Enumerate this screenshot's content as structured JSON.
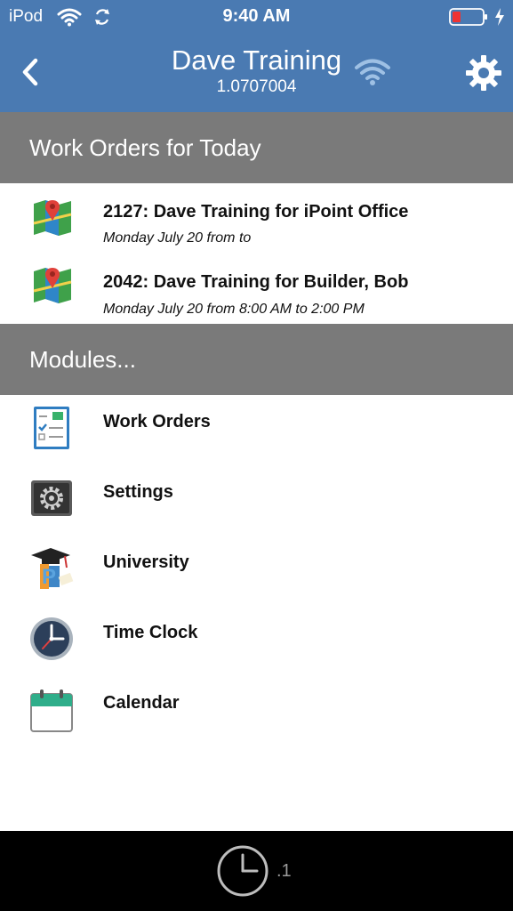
{
  "status_bar": {
    "carrier": "iPod",
    "time": "9:40 AM",
    "icons": [
      "wifi-icon",
      "sync-icon",
      "battery-icon",
      "charging-icon"
    ]
  },
  "header": {
    "title": "Dave Training",
    "subtitle": "1.0707004",
    "back_icon": "chevron-left-icon",
    "connection_icon": "wifi-icon",
    "settings_icon": "gear-icon"
  },
  "work_orders_section": {
    "heading": "Work Orders for Today",
    "items": [
      {
        "title": "2127: Dave Training for iPoint Office",
        "subtitle": "Monday July 20 from  to",
        "icon": "map-pin-icon"
      },
      {
        "title": "2042: Dave Training for Builder, Bob",
        "subtitle": "Monday July 20 from 8:00 AM to 2:00 PM",
        "icon": "map-pin-icon"
      }
    ]
  },
  "modules_section": {
    "heading": "Modules...",
    "items": [
      {
        "label": "Work Orders",
        "icon": "clipboard-icon"
      },
      {
        "label": "Settings",
        "icon": "settings-icon"
      },
      {
        "label": "University",
        "icon": "graduation-cap-icon"
      },
      {
        "label": "Time Clock",
        "icon": "clock-icon"
      },
      {
        "label": "Calendar",
        "icon": "calendar-icon"
      }
    ]
  },
  "bottom_bar": {
    "icon": "clock-icon",
    "count": ".1"
  },
  "colors": {
    "header_blue": "#4a7ab2",
    "section_gray": "#7a7a7a",
    "bottom_black": "#000000"
  }
}
